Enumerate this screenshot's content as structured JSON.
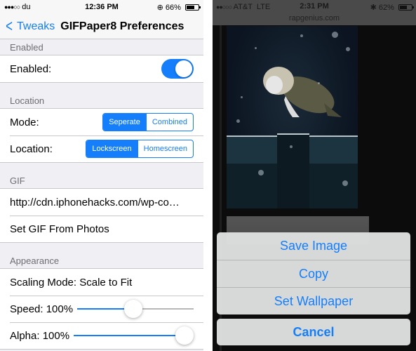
{
  "left_screen": {
    "status_bar": {
      "carrier": "du",
      "signal_dots": "●●●○○",
      "time": "12:36 PM",
      "rotation_lock_icon": "rotation-lock-icon",
      "battery_percent": "66%",
      "battery_level": 0.66
    },
    "nav": {
      "back_label": "Tweaks",
      "title": "GIFPaper8 Preferences"
    },
    "sections": {
      "enabled": {
        "header": "Enabled",
        "enabled_label": "Enabled:",
        "enabled_value": true
      },
      "location": {
        "header": "Location",
        "mode_label": "Mode:",
        "mode_options": [
          "Seperate",
          "Combined"
        ],
        "mode_selected": "Seperate",
        "location_label": "Location:",
        "location_options": [
          "Lockscreen",
          "Homescreen"
        ],
        "location_selected": "Lockscreen"
      },
      "gif": {
        "header": "GIF",
        "url": "http://cdn.iphonehacks.com/wp-co…",
        "set_from_photos": "Set GIF From Photos"
      },
      "appearance": {
        "header": "Appearance",
        "scaling_mode": "Scaling Mode: Scale to Fit",
        "speed_label": "Speed: 100%",
        "speed_slider_fraction": 0.48,
        "alpha_label": "Alpha: 100%",
        "alpha_slider_fraction": 1.0
      }
    },
    "colors": {
      "accent": "#147efb",
      "background": "#efeff4"
    }
  },
  "right_screen": {
    "status_bar": {
      "signal_dots": "●●○○○",
      "carrier": "AT&T",
      "network": "LTE",
      "time": "2:31 PM",
      "bluetooth_icon": "bluetooth-icon",
      "battery_percent": "62%",
      "battery_level": 0.62
    },
    "url": "rapgenius.com",
    "action_sheet": {
      "items": [
        "Save Image",
        "Copy",
        "Set Wallpaper"
      ],
      "cancel": "Cancel"
    }
  }
}
